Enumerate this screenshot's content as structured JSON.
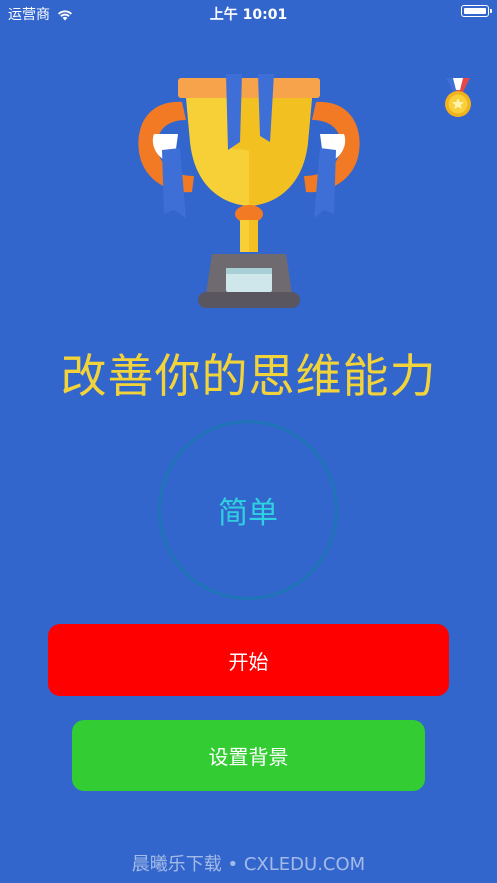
{
  "status_bar": {
    "carrier": "运营商",
    "time": "上午 10:01"
  },
  "icons": {
    "wifi": "wifi-icon",
    "battery": "battery-icon",
    "medal": "medal-icon",
    "trophy": "trophy-image"
  },
  "main": {
    "title": "改善你的思维能力",
    "difficulty": "简单",
    "start_label": "开始",
    "background_label": "设置背景"
  },
  "watermark": "晨曦乐下载 • CXLEDU.COM",
  "colors": {
    "background": "#3366cc",
    "title": "#f2d33a",
    "difficulty_text": "#2fd0e0",
    "start_button": "#ff0000",
    "background_button": "#33cc33"
  }
}
